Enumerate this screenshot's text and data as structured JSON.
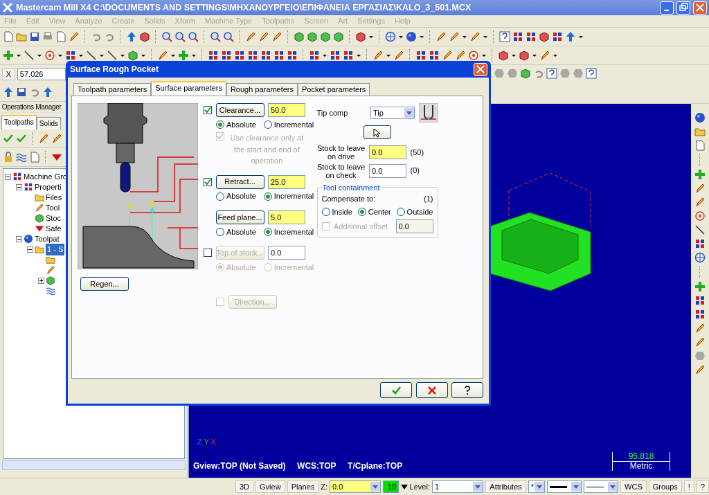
{
  "window": {
    "title": "Mastercam Mill X4  C:\\DOCUMENTS AND SETTINGS\\ΜΗΧΑΝΟΥΡΓΕΙΟ\\ΕΠΙΦΑΝΕΙΑ ΕΡΓΑΣΙΑΣ\\KALO_3_501.MCX"
  },
  "menu": {
    "disabled": true,
    "items": [
      "File",
      "Edit",
      "View",
      "Analyze",
      "Create",
      "Solids",
      "Xform",
      "Machine Type",
      "Toolpaths",
      "Screen",
      "Art",
      "Settings",
      "Help"
    ]
  },
  "coord_field": {
    "axis": "X",
    "value": "57.026"
  },
  "ops_manager": {
    "title": "Operations Manager",
    "tabs": [
      {
        "label": "Toolpaths",
        "selected": true
      },
      {
        "label": "Solids",
        "selected": false
      }
    ],
    "tree": [
      {
        "kind": "machine",
        "label": "Machine Gro",
        "selected": false,
        "expanded": true,
        "children": [
          {
            "kind": "properties",
            "label": "Properti",
            "selected": false,
            "expanded": true,
            "children": [
              {
                "kind": "folder",
                "label": "Files",
                "selected": false
              },
              {
                "kind": "tool",
                "label": "Tool",
                "selected": false
              },
              {
                "kind": "stock",
                "label": "Stoc",
                "selected": false
              },
              {
                "kind": "safety",
                "label": "Safe",
                "selected": false
              }
            ]
          },
          {
            "kind": "toolpaths",
            "label": "Toolpat",
            "selected": false,
            "expanded": true,
            "children": [
              {
                "kind": "operation",
                "label": "1 - S",
                "selected": true,
                "expanded": true,
                "children": [
                  {
                    "kind": "folder",
                    "selected": false
                  },
                  {
                    "kind": "tool",
                    "selected": false
                  },
                  {
                    "kind": "geometry",
                    "selected": false,
                    "expanded": false
                  },
                  {
                    "kind": "path",
                    "selected": false
                  }
                ]
              }
            ]
          }
        ]
      }
    ]
  },
  "dialog": {
    "title": "Surface Rough Pocket",
    "tabs": [
      {
        "label": "Toolpath parameters",
        "selected": false
      },
      {
        "label": "Surface parameters",
        "selected": true
      },
      {
        "label": "Rough parameters",
        "selected": false
      },
      {
        "label": "Pocket parameters",
        "selected": false
      }
    ],
    "regen": "Regen...",
    "heights": [
      {
        "kind": "checkable",
        "checked": true,
        "disabled": false,
        "button": "Clearance...",
        "value": "50.0",
        "highlighted": true,
        "modes": [
          {
            "label": "Absolute",
            "selected": true
          },
          {
            "label": "Incremental",
            "selected": false
          }
        ],
        "option": {
          "label": "Use clearance only at the start and end of operation",
          "checked": true,
          "disabled": true
        }
      },
      {
        "kind": "checkable",
        "checked": true,
        "disabled": false,
        "button": "Retract...",
        "value": "25.0",
        "highlighted": true,
        "modes": [
          {
            "label": "Absolute",
            "selected": false
          },
          {
            "label": "Incremental",
            "selected": true
          }
        ]
      },
      {
        "kind": "plain",
        "disabled": false,
        "button": "Feed plane...",
        "value": "5.0",
        "highlighted": true,
        "modes": [
          {
            "label": "Absolute",
            "selected": false
          },
          {
            "label": "Incremental",
            "selected": true
          }
        ]
      },
      {
        "kind": "checkable",
        "checked": false,
        "disabled": true,
        "button": "Top of stock...",
        "value": "0.0",
        "highlighted": false,
        "modes": [
          {
            "label": "Absolute",
            "selected": true
          },
          {
            "label": "Incremental",
            "selected": false
          }
        ]
      }
    ],
    "tip_comp": {
      "label": "Tip comp",
      "value": "Tip"
    },
    "stock": [
      {
        "label": "Stock to leave on drive",
        "value": "0.0",
        "note": "(50)",
        "highlighted": true
      },
      {
        "label": "Stock to leave on check",
        "value": "0.0",
        "note": "(0)",
        "highlighted": false
      }
    ],
    "containment": {
      "title": "Tool containment",
      "compensate_label": "Compensate to:",
      "count": "(1)",
      "options": [
        {
          "label": "Inside",
          "selected": false
        },
        {
          "label": "Center",
          "selected": true
        },
        {
          "label": "Outside",
          "selected": false
        }
      ],
      "offset": {
        "label": "Additional offset",
        "checked": false,
        "disabled": true,
        "value": "0.0"
      }
    },
    "direction": {
      "label": "Direction...",
      "checked": false,
      "disabled": true
    }
  },
  "viewport": {
    "triad": {
      "z": "Z",
      "y": "Y",
      "x": "X"
    },
    "status": [
      "Gview:TOP (Not Saved)",
      "WCS:TOP",
      "T/Cplane:TOP"
    ],
    "scale": {
      "value": "95.818",
      "unit": "Metric"
    }
  },
  "status_bar": [
    {
      "kind": "button",
      "label": "3D"
    },
    {
      "kind": "button",
      "label": "Gview"
    },
    {
      "kind": "button",
      "label": "Planes"
    },
    {
      "kind": "field",
      "label": "Z:",
      "value": "0.0",
      "highlighted": true
    },
    {
      "kind": "color",
      "value": "10",
      "color": "#00dd00"
    },
    {
      "kind": "field",
      "label": "Level:",
      "value": "1",
      "highlighted": false
    },
    {
      "kind": "button",
      "label": "Attributes"
    },
    {
      "kind": "combo",
      "value": "*"
    },
    {
      "kind": "thickline"
    },
    {
      "kind": "thinline"
    },
    {
      "kind": "button",
      "label": "WCS"
    },
    {
      "kind": "button",
      "label": "Groups"
    },
    {
      "kind": "button",
      "label": "!"
    },
    {
      "kind": "button",
      "label": "?"
    }
  ]
}
